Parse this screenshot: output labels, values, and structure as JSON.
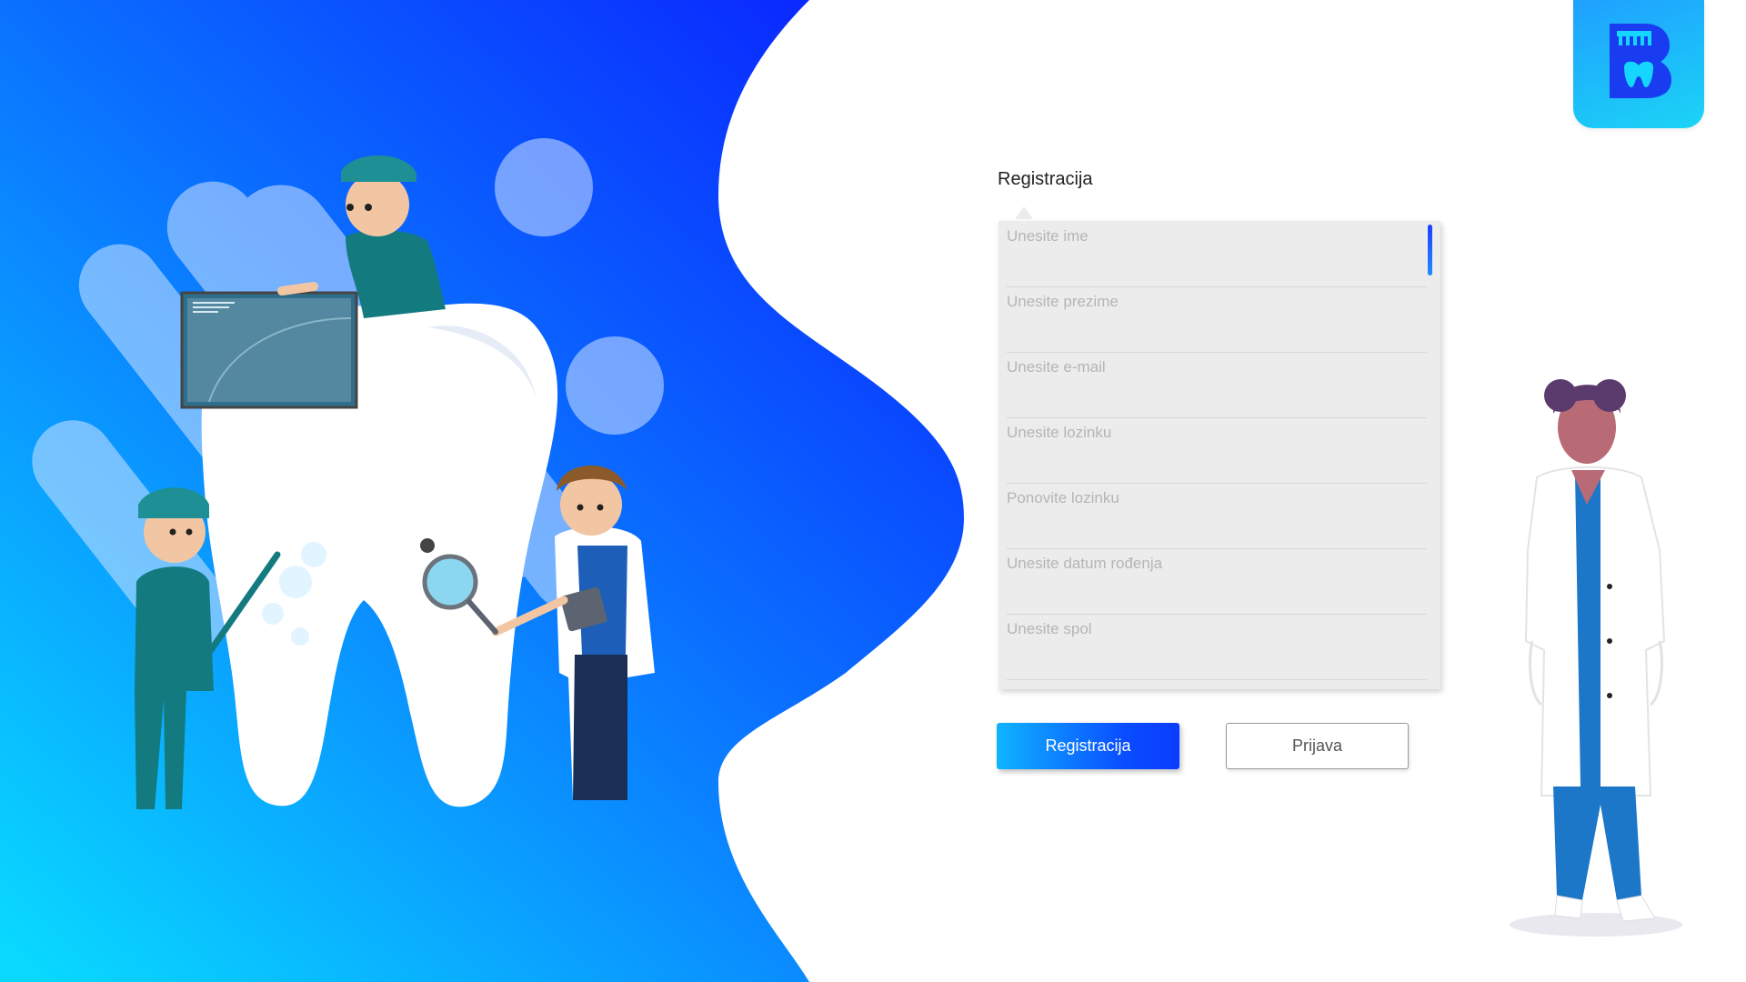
{
  "form": {
    "title": "Registracija",
    "fields": [
      {
        "placeholder": "Unesite ime",
        "value": ""
      },
      {
        "placeholder": "Unesite prezime",
        "value": ""
      },
      {
        "placeholder": "Unesite e-mail",
        "value": ""
      },
      {
        "placeholder": "Unesite lozinku",
        "value": ""
      },
      {
        "placeholder": "Ponovite lozinku",
        "value": ""
      },
      {
        "placeholder": "Unesite datum rođenja",
        "value": ""
      },
      {
        "placeholder": "Unesite spol",
        "value": ""
      }
    ]
  },
  "buttons": {
    "register_label": "Registracija",
    "login_label": "Prijava"
  },
  "icons": {
    "logo": "tooth-logo-icon"
  },
  "colors": {
    "primary_blue": "#0a3cff",
    "accent_cyan": "#10d2ff",
    "form_background": "#ececec"
  }
}
